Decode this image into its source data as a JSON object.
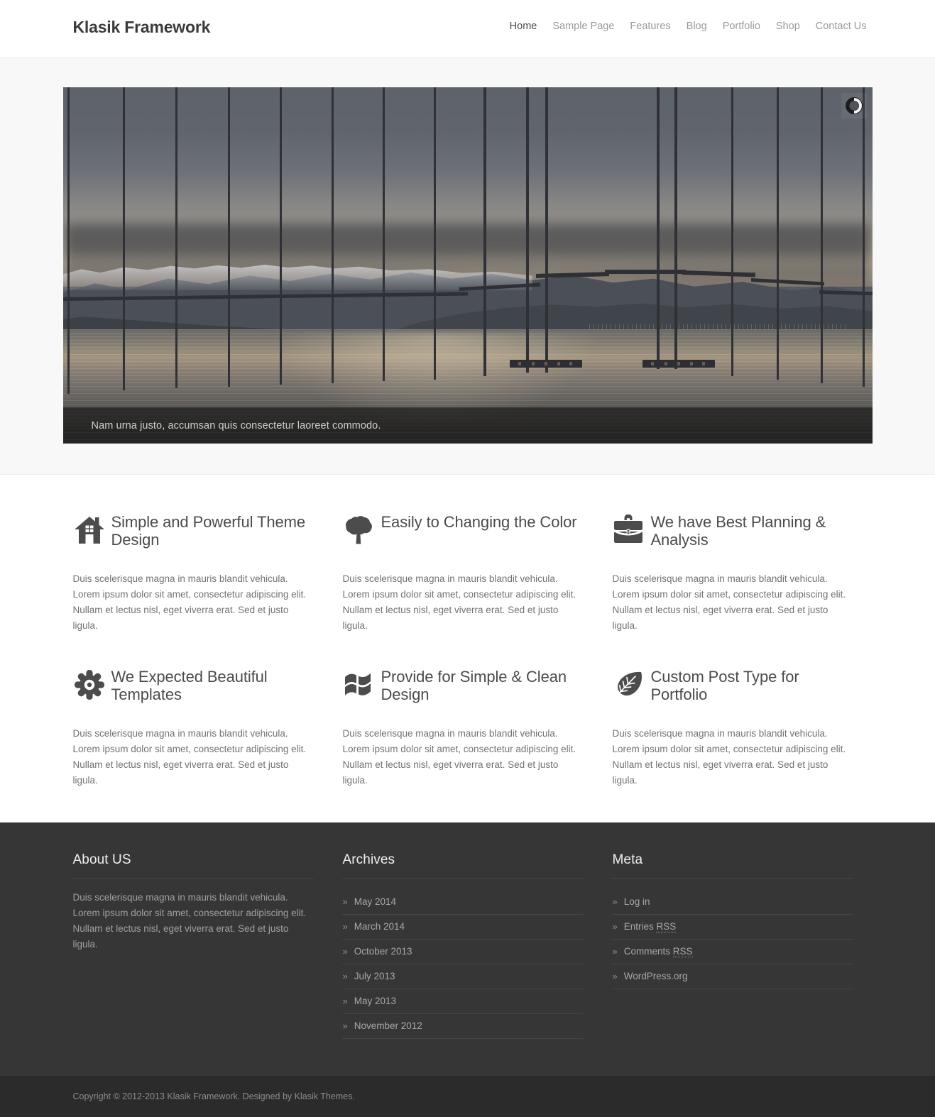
{
  "header": {
    "logo": "Klasik Framework",
    "nav": [
      {
        "label": "Home",
        "active": true
      },
      {
        "label": "Sample Page",
        "active": false
      },
      {
        "label": "Features",
        "active": false
      },
      {
        "label": "Blog",
        "active": false
      },
      {
        "label": "Portfolio",
        "active": false
      },
      {
        "label": "Shop",
        "active": false
      },
      {
        "label": "Contact Us",
        "active": false
      }
    ]
  },
  "slider": {
    "caption": "Nam urna justo, accumsan quis consectetur laoreet commodo.",
    "loader_icon": "loading-spinner-icon",
    "image_description": "Silhouette of a long bridge over a calm fjord at dusk with snow-capped mountains in the background"
  },
  "features": [
    {
      "icon": "house-icon",
      "title": "Simple and Powerful Theme Design",
      "text": "Duis scelerisque magna in mauris blandit vehicula. Lorem ipsum dolor sit amet, consectetur adipiscing elit. Nullam et lectus nisl, eget viverra erat. Sed et justo ligula."
    },
    {
      "icon": "tree-icon",
      "title": "Easily to Changing the Color",
      "text": "Duis scelerisque magna in mauris blandit vehicula. Lorem ipsum dolor sit amet, consectetur adipiscing elit. Nullam et lectus nisl, eget viverra erat. Sed et justo ligula."
    },
    {
      "icon": "briefcase-icon",
      "title": "We have Best Planning & Analysis",
      "text": "Duis scelerisque magna in mauris blandit vehicula. Lorem ipsum dolor sit amet, consectetur adipiscing elit. Nullam et lectus nisl, eget viverra erat. Sed et justo ligula."
    },
    {
      "icon": "gear-icon",
      "title": "We Expected Beautiful Templates",
      "text": "Duis scelerisque magna in mauris blandit vehicula. Lorem ipsum dolor sit amet, consectetur adipiscing elit. Nullam et lectus nisl, eget viverra erat. Sed et justo ligula."
    },
    {
      "icon": "windows-flag-icon",
      "title": "Provide for Simple & Clean Design",
      "text": "Duis scelerisque magna in mauris blandit vehicula. Lorem ipsum dolor sit amet, consectetur adipiscing elit. Nullam et lectus nisl, eget viverra erat. Sed et justo ligula."
    },
    {
      "icon": "leaf-icon",
      "title": "Custom Post Type for Portfolio",
      "text": "Duis scelerisque magna in mauris blandit vehicula. Lorem ipsum dolor sit amet, consectetur adipiscing elit. Nullam et lectus nisl, eget viverra erat. Sed et justo ligula."
    }
  ],
  "footer": {
    "about": {
      "title": "About US",
      "text": "Duis scelerisque magna in mauris blandit vehicula. Lorem ipsum dolor sit amet, consectetur adipiscing elit. Nullam et lectus nisl, eget viverra erat. Sed et justo ligula."
    },
    "archives": {
      "title": "Archives",
      "bullet": "»",
      "items": [
        {
          "label": "May 2014"
        },
        {
          "label": "March 2014"
        },
        {
          "label": "October 2013"
        },
        {
          "label": "July 2013"
        },
        {
          "label": "May 2013"
        },
        {
          "label": "November 2012"
        }
      ]
    },
    "meta": {
      "title": "Meta",
      "bullet": "»",
      "items": [
        {
          "label": "Log in",
          "abbr": null
        },
        {
          "label": "Entries ",
          "abbr": "RSS"
        },
        {
          "label": "Comments ",
          "abbr": "RSS"
        },
        {
          "label": "WordPress.org",
          "abbr": null
        }
      ]
    }
  },
  "copyright": {
    "text": "Copyright © 2012-2013 Klasik Framework. Designed by Klasik Themes."
  },
  "colors": {
    "page_bg": "#ffffff",
    "slider_bg": "#f8f8f8",
    "footer_bg": "#363636",
    "copyright_bg": "#2b2b2b",
    "text_dark": "#4b4b4b",
    "text_muted": "#727272",
    "nav_muted": "#9a9a9a"
  }
}
